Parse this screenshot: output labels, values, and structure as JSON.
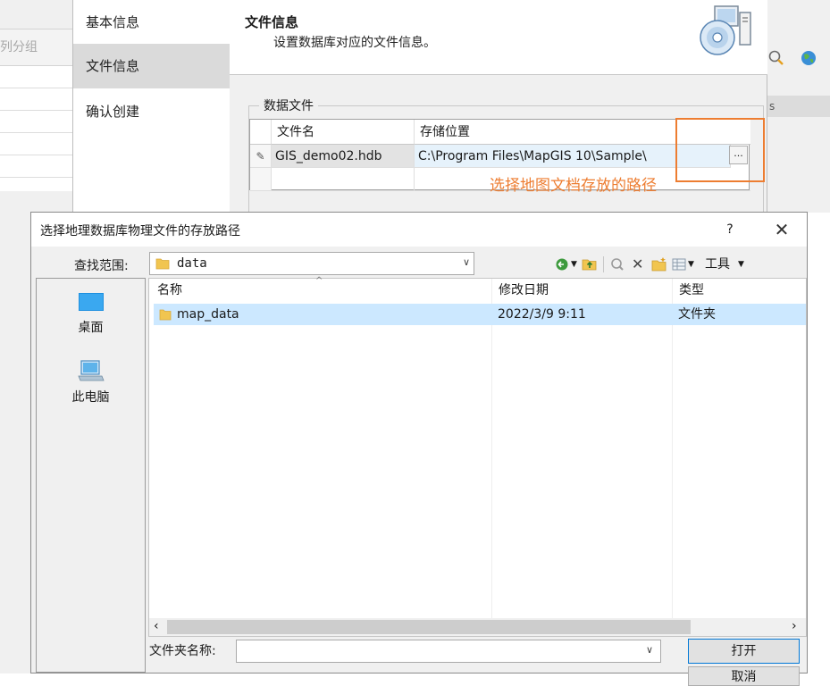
{
  "background_app": {
    "column_group_label": "列分组",
    "right_header_fragment": "s"
  },
  "wizard": {
    "nav_items": [
      {
        "label": "基本信息",
        "active": false
      },
      {
        "label": "文件信息",
        "active": true
      },
      {
        "label": "确认创建",
        "active": false
      }
    ],
    "header_title": "文件信息",
    "header_subtitle": "设置数据库对应的文件信息。",
    "fieldset_legend": "数据文件",
    "table": {
      "columns": [
        "文件名",
        "存储位置"
      ],
      "rows": [
        {
          "file_name": "GIS_demo02.hdb",
          "location": "C:\\Program Files\\MapGIS 10\\Sample\\",
          "browse": "..."
        }
      ]
    },
    "callout_text": "选择地图文档存放的路径",
    "accent_color": "#ed7d31"
  },
  "file_dialog": {
    "title": "选择地理数据库物理文件的存放路径",
    "help": "?",
    "close": "✕",
    "look_in_label": "查找范围:",
    "look_in_value": "data",
    "toolbar_tools_label": "工具",
    "places": [
      {
        "label": "桌面",
        "icon": "desktop-icon"
      },
      {
        "label": "此电脑",
        "icon": "computer-icon"
      }
    ],
    "columns": [
      "名称",
      "修改日期",
      "类型"
    ],
    "rows": [
      {
        "name": "map_data",
        "modified": "2022/3/9 9:11",
        "type": "文件夹"
      }
    ],
    "folder_name_label": "文件夹名称:",
    "folder_name_value": "",
    "open_label": "打开",
    "cancel_label": "取消",
    "selection_color": "#cce8ff"
  }
}
